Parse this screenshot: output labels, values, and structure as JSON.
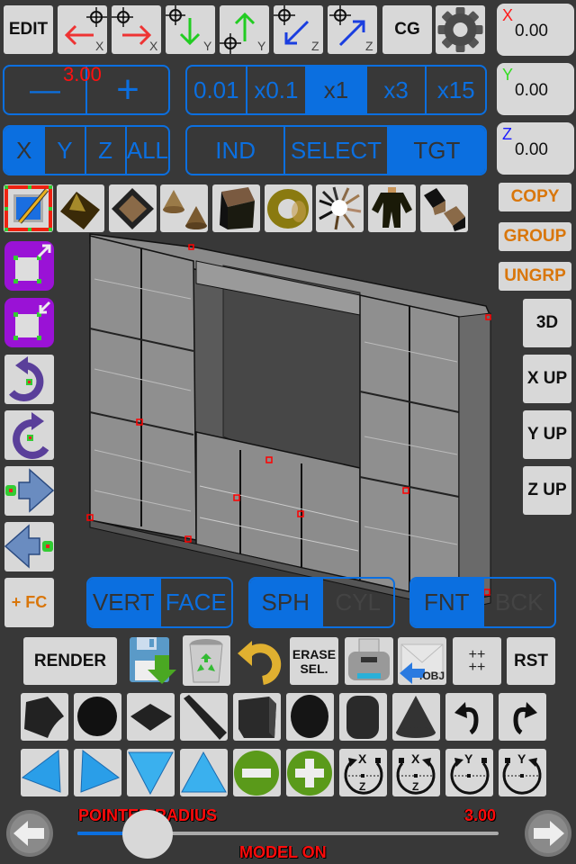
{
  "top_toolbar": {
    "edit_label": "EDIT",
    "move_buttons": [
      {
        "name": "move-x-negative",
        "icon": "arrow-left-red-icon",
        "axis": "X"
      },
      {
        "name": "move-x-positive",
        "icon": "arrow-right-red-icon",
        "axis": "X"
      },
      {
        "name": "move-y-negative",
        "icon": "arrow-down-green-icon",
        "axis": "Y"
      },
      {
        "name": "move-y-positive",
        "icon": "arrow-up-green-icon",
        "axis": "Y"
      },
      {
        "name": "move-z-negative",
        "icon": "arrow-down-left-blue-icon",
        "axis": "Z"
      },
      {
        "name": "move-z-positive",
        "icon": "arrow-up-right-blue-icon",
        "axis": "Z"
      }
    ],
    "cg_label": "CG",
    "settings_icon": "gear-icon"
  },
  "coordinates": {
    "x": {
      "axis": "X",
      "value": "0.00",
      "color": "#ff1a1a"
    },
    "y": {
      "axis": "Y",
      "value": "0.00",
      "color": "#33dd22"
    },
    "z": {
      "axis": "Z",
      "value": "0.00",
      "color": "#1a1aff"
    }
  },
  "step_control": {
    "minus_label": "—",
    "plus_label": "+",
    "value": "3.00"
  },
  "multiplier": {
    "options": [
      "0.01",
      "x0.1",
      "x1",
      "x3",
      "x15"
    ],
    "selected": "x1"
  },
  "axis_select": {
    "options": [
      "X",
      "Y",
      "Z",
      "ALL"
    ],
    "selected": "X"
  },
  "mode_select": {
    "options": [
      "IND",
      "SELECT",
      "TGT"
    ],
    "selected": "TGT"
  },
  "shape_library": {
    "items": [
      {
        "name": "edit-texture",
        "icon": "pencil-canvas-icon"
      },
      {
        "name": "terrain",
        "icon": "terrain-mesh-icon"
      },
      {
        "name": "pyramid",
        "icon": "pyramid-mesh-icon"
      },
      {
        "name": "cones",
        "icon": "cones-icon"
      },
      {
        "name": "cube-stack",
        "icon": "cube-stack-icon"
      },
      {
        "name": "torus",
        "icon": "torus-icon"
      },
      {
        "name": "spiral-blades",
        "icon": "spiral-blades-icon"
      },
      {
        "name": "figure",
        "icon": "humanoid-figure-icon"
      },
      {
        "name": "twin-cubes",
        "icon": "twin-cubes-icon"
      }
    ]
  },
  "right_actions": {
    "copy": "COPY",
    "group": "GROUP",
    "ungroup": "UNGRP",
    "view_3d": "3D",
    "x_up": "X UP",
    "y_up": "Y UP",
    "z_up": "Z UP"
  },
  "left_tools": {
    "items": [
      {
        "name": "scale-up",
        "icon": "scale-up-icon"
      },
      {
        "name": "scale-down",
        "icon": "scale-down-icon"
      },
      {
        "name": "rotate-ccw",
        "icon": "rotate-counterclockwise-icon"
      },
      {
        "name": "rotate-cw",
        "icon": "rotate-clockwise-icon"
      },
      {
        "name": "push-right",
        "icon": "arrow-push-right-icon"
      },
      {
        "name": "push-left",
        "icon": "arrow-push-left-icon"
      }
    ],
    "add_fc_label": "+ FC"
  },
  "selection_toggles": {
    "vert_face": {
      "options": [
        "VERT",
        "FACE"
      ],
      "selected": "VERT"
    },
    "sph_cyl": {
      "options": [
        "SPH",
        "CYL"
      ],
      "selected": "SPH"
    },
    "fnt_bck": {
      "options": [
        "FNT",
        "BCK"
      ],
      "selected": "FNT"
    }
  },
  "action_row": {
    "render": "RENDER",
    "save_icon": "save-download-icon",
    "recycle_icon": "recycle-bin-icon",
    "undo_icon": "undo-curved-arrow-icon",
    "erase_sel_line1": "ERASE",
    "erase_sel_line2": "SEL.",
    "print_icon": "printer-icon",
    "export_obj_label": ".OBJ",
    "grid_plus_top": "++",
    "grid_plus_bottom": "++",
    "reset": "RST"
  },
  "primitives_row": [
    {
      "name": "curved-plane",
      "icon": "curved-plane-icon"
    },
    {
      "name": "disc",
      "icon": "disc-icon"
    },
    {
      "name": "diamond-plane",
      "icon": "diamond-plane-icon"
    },
    {
      "name": "slanted-plane",
      "icon": "slanted-plane-icon"
    },
    {
      "name": "box",
      "icon": "box-icon"
    },
    {
      "name": "sphere",
      "icon": "sphere-icon"
    },
    {
      "name": "cylinder",
      "icon": "cylinder-icon"
    },
    {
      "name": "cone",
      "icon": "cone-icon"
    },
    {
      "name": "undo",
      "icon": "undo-icon"
    },
    {
      "name": "redo",
      "icon": "redo-icon"
    }
  ],
  "transform_row": [
    {
      "name": "tilt-left",
      "icon": "triangle-left-icon"
    },
    {
      "name": "tilt-right",
      "icon": "triangle-right-icon"
    },
    {
      "name": "tilt-down",
      "icon": "triangle-down-icon"
    },
    {
      "name": "tilt-up",
      "icon": "triangle-up-icon"
    },
    {
      "name": "decrease",
      "icon": "minus-circle-icon"
    },
    {
      "name": "increase",
      "icon": "plus-circle-icon"
    },
    {
      "name": "rotate-xz-ccw",
      "icon": "rotate-x-z-ccw-icon",
      "top": "X",
      "bottom": "Z"
    },
    {
      "name": "rotate-xz-cw",
      "icon": "rotate-x-z-cw-icon",
      "top": "X",
      "bottom": "Z"
    },
    {
      "name": "rotate-y-ccw",
      "icon": "rotate-y-ccw-icon",
      "top": "Y"
    },
    {
      "name": "rotate-y-cw",
      "icon": "rotate-y-cw-icon",
      "top": "Y"
    }
  ],
  "bottom_bar": {
    "slider_label": "POINTER RADIUS",
    "slider_value": "3.00",
    "slider_fraction": 0.06,
    "status": "MODEL ON",
    "prev_icon": "arrow-left-circle-icon",
    "next_icon": "arrow-right-circle-icon"
  }
}
